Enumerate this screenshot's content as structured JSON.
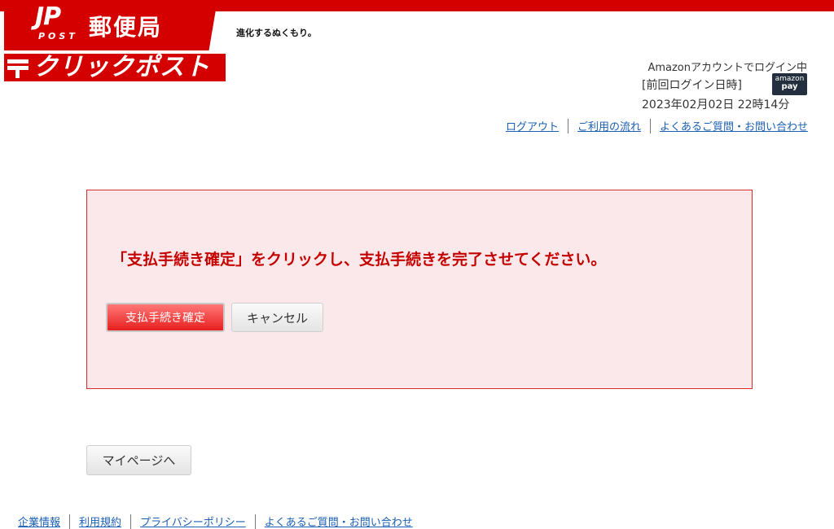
{
  "header": {
    "jp_mark": "JP",
    "jp_post": "POST",
    "jp_name": "郵便局",
    "tagline": "進化するぬくもり。",
    "service_logo_text": "クリックポスト"
  },
  "account": {
    "login_status": "Amazonアカウントでログイン中",
    "last_login_label": "[前回ログイン日時]",
    "last_login_value": "2023年02月02日 22時14分",
    "amazon_pay_line1": "amazon",
    "amazon_pay_line2": "pay"
  },
  "top_nav": {
    "logout": "ログアウト",
    "flow": "ご利用の流れ",
    "faq": "よくあるご質問・お問い合わせ"
  },
  "panel": {
    "message": "「支払手続き確定」をクリックし、支払手続きを完了させてください。",
    "confirm_label": "支払手続き確定",
    "cancel_label": "キャンセル"
  },
  "mypage_label": "マイページへ",
  "footer_nav": {
    "company": "企業情報",
    "terms": "利用規約",
    "privacy": "プライバシーポリシー",
    "faq": "よくあるご質問・お問い合わせ"
  },
  "colors": {
    "brand_red": "#d40000",
    "panel_bg": "#fbe8ea",
    "message_red": "#c40000",
    "link_blue": "#1a5fb4"
  },
  "icons": {
    "post_mark": "post-mark-icon",
    "amazon_pay": "amazon-pay-icon"
  }
}
